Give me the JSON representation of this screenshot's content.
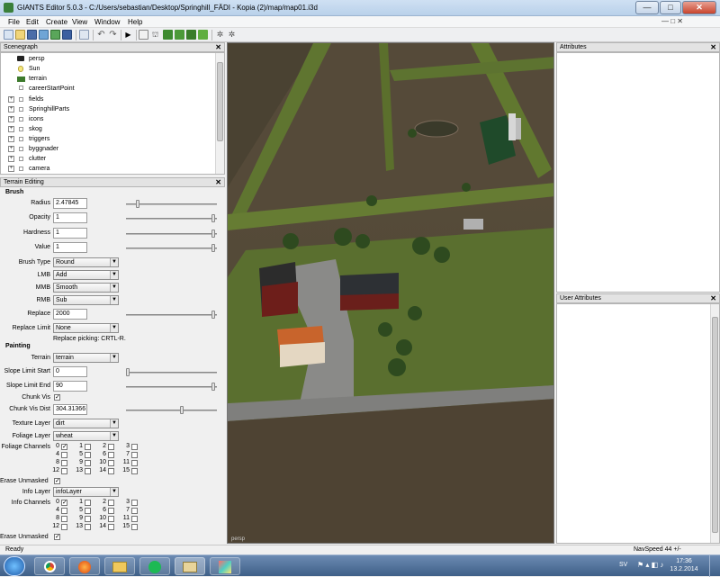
{
  "window": {
    "title": "GIANTS Editor 5.0.3 - C:/Users/sebastian/Desktop/Springhill_FÄDI - Kopia (2)/map/map01.i3d",
    "minimize": "—",
    "maximize": "□",
    "close": "✕"
  },
  "menu": [
    "File",
    "Edit",
    "Create",
    "View",
    "Window",
    "Help"
  ],
  "toolbar": {
    "icons": [
      "new-icon",
      "open-icon",
      "save-icon",
      "import-icon",
      "export-icon",
      "save-all-icon",
      "copy-icon",
      "undo-icon",
      "redo-icon",
      "play-icon",
      "select-icon",
      "move-icon",
      "terrain-sculpt-icon",
      "terrain-paint-icon",
      "foliage-icon",
      "foliage-paint-icon",
      "settings-icon",
      "gizmo-icon"
    ]
  },
  "scenegraph": {
    "title": "Scenegraph",
    "close": "✕",
    "items": [
      {
        "label": "persp",
        "icon": "camera-icon",
        "expandable": false
      },
      {
        "label": "Sun",
        "icon": "light-icon",
        "expandable": false
      },
      {
        "label": "terrain",
        "icon": "terrain-icon",
        "expandable": false
      },
      {
        "label": "careerStartPoint",
        "icon": "transform-icon",
        "expandable": false
      },
      {
        "label": "fields",
        "icon": "transform-icon",
        "expandable": true
      },
      {
        "label": "SpringhillParts",
        "icon": "transform-icon",
        "expandable": true
      },
      {
        "label": "icons",
        "icon": "transform-icon",
        "expandable": true
      },
      {
        "label": "skog",
        "icon": "transform-icon",
        "expandable": true
      },
      {
        "label": "triggers",
        "icon": "transform-icon",
        "expandable": true
      },
      {
        "label": "byggnader",
        "icon": "transform-icon",
        "expandable": true
      },
      {
        "label": "clutter",
        "icon": "transform-icon",
        "expandable": true
      },
      {
        "label": "camera",
        "icon": "transform-icon",
        "expandable": true
      }
    ]
  },
  "terrain": {
    "title": "Terrain Editing",
    "close": "✕",
    "brush_heading": "Brush",
    "radius_label": "Radius",
    "radius_value": "2.47845",
    "opacity_label": "Opacity",
    "opacity_value": "1",
    "hardness_label": "Hardness",
    "hardness_value": "1",
    "value_label": "Value",
    "value_value": "1",
    "brush_type_label": "Brush Type",
    "brush_type_value": "Round",
    "lmb_label": "LMB",
    "lmb_value": "Add",
    "mmb_label": "MMB",
    "mmb_value": "Smooth",
    "rmb_label": "RMB",
    "rmb_value": "Sub",
    "replace_label": "Replace",
    "replace_value": "2000",
    "replace_limit_label": "Replace Limit",
    "replace_limit_value": "None",
    "replace_picking_hint": "Replace picking: CRTL-R.",
    "painting_heading": "Painting",
    "terrain_label": "Terrain",
    "terrain_value": "terrain",
    "slope_start_label": "Slope Limit Start",
    "slope_start_value": "0",
    "slope_end_label": "Slope Limit End",
    "slope_end_value": "90",
    "chunk_vis_label": "Chunk Vis",
    "chunk_vis_dist_label": "Chunk Vis Dist",
    "chunk_vis_dist_value": "304.31366",
    "texture_layer_label": "Texture Layer",
    "texture_layer_value": "dirt",
    "foliage_layer_label": "Foliage Layer",
    "foliage_layer_value": "wheat",
    "foliage_channels_label": "Foliage Channels",
    "erase_unmasked_label": "Erase Unmasked",
    "info_layer_label": "Info Layer",
    "info_layer_value": "infoLayer",
    "info_channels_label": "Info Channels",
    "erase_unmasked2_label": "Erase Unmasked",
    "channels": [
      "0",
      "1",
      "2",
      "3",
      "4",
      "5",
      "6",
      "7",
      "8",
      "9",
      "10",
      "11",
      "12",
      "13",
      "14",
      "15"
    ]
  },
  "sliders": {
    "radius": 0.12,
    "opacity": 1.0,
    "hardness": 1.0,
    "value": 1.0,
    "replace": 1.0,
    "slope_start": 0.0,
    "slope_end": 1.0,
    "chunk_vis_dist": 0.63
  },
  "viewport": {
    "camera_label": "persp"
  },
  "attributes": {
    "title": "Attributes",
    "close": "✕"
  },
  "user_attributes": {
    "title": "User Attributes",
    "close": "✕"
  },
  "status": {
    "left": "Ready",
    "nav": "NavSpeed 44 +/-"
  },
  "taskbar": {
    "apps": [
      "chrome-icon",
      "firefox-icon",
      "explorer-icon",
      "spotify-icon",
      "giants-editor-icon",
      "paint-icon"
    ],
    "lang": "SV",
    "time": "17:36",
    "date": "13.2.2014"
  },
  "colors": {
    "field": "#4e4333",
    "grass": "#5f7530",
    "road": "#8a8a88"
  }
}
